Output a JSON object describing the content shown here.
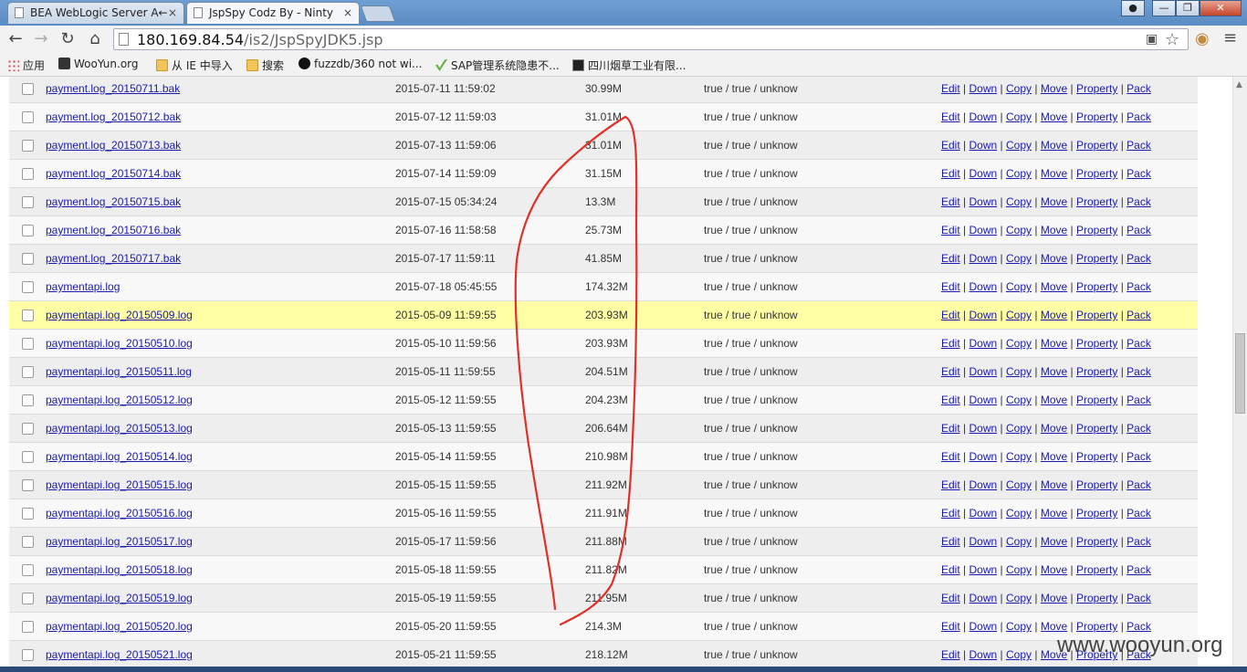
{
  "browser": {
    "tabs": [
      {
        "label": "BEA WebLogic Server A←",
        "active": false
      },
      {
        "label": "JspSpy Codz By - Ninty",
        "active": true
      }
    ],
    "close_glyph": "×",
    "url_host": "180.169.84.54",
    "url_path": "/is2/JspSpyJDK5.jsp",
    "bookmarks": [
      {
        "label": "应用",
        "icon": "apps-grid-icon"
      },
      {
        "label": "WooYun.org",
        "icon": "wooyun-icon"
      },
      {
        "label": "从 IE 中导入",
        "icon": "folder-icon"
      },
      {
        "label": "搜索",
        "icon": "folder-icon"
      },
      {
        "label": "fuzzdb/360 not wi...",
        "icon": "github-icon"
      },
      {
        "label": "SAP管理系统隐患不...",
        "icon": "sap-icon"
      },
      {
        "label": "四川烟草工业有限...",
        "icon": "site-icon"
      }
    ]
  },
  "actions": {
    "edit": "Edit",
    "down": "Down",
    "copy": "Copy",
    "move": "Move",
    "property": "Property",
    "pack": "Pack",
    "separator": "|"
  },
  "files": [
    {
      "name": "payment.log_20150711.bak",
      "date": "2015-07-11 11:59:02",
      "size": "30.99M",
      "perm": "true / true / unknow"
    },
    {
      "name": "payment.log_20150712.bak",
      "date": "2015-07-12 11:59:03",
      "size": "31.01M",
      "perm": "true / true / unknow"
    },
    {
      "name": "payment.log_20150713.bak",
      "date": "2015-07-13 11:59:06",
      "size": "31.01M",
      "perm": "true / true / unknow"
    },
    {
      "name": "payment.log_20150714.bak",
      "date": "2015-07-14 11:59:09",
      "size": "31.15M",
      "perm": "true / true / unknow"
    },
    {
      "name": "payment.log_20150715.bak",
      "date": "2015-07-15 05:34:24",
      "size": "13.3M",
      "perm": "true / true / unknow"
    },
    {
      "name": "payment.log_20150716.bak",
      "date": "2015-07-16 11:58:58",
      "size": "25.73M",
      "perm": "true / true / unknow"
    },
    {
      "name": "payment.log_20150717.bak",
      "date": "2015-07-17 11:59:11",
      "size": "41.85M",
      "perm": "true / true / unknow"
    },
    {
      "name": "paymentapi.log",
      "date": "2015-07-18 05:45:55",
      "size": "174.32M",
      "perm": "true / true / unknow"
    },
    {
      "name": "paymentapi.log_20150509.log",
      "date": "2015-05-09 11:59:55",
      "size": "203.93M",
      "perm": "true / true / unknow"
    },
    {
      "name": "paymentapi.log_20150510.log",
      "date": "2015-05-10 11:59:56",
      "size": "203.93M",
      "perm": "true / true / unknow"
    },
    {
      "name": "paymentapi.log_20150511.log",
      "date": "2015-05-11 11:59:55",
      "size": "204.51M",
      "perm": "true / true / unknow"
    },
    {
      "name": "paymentapi.log_20150512.log",
      "date": "2015-05-12 11:59:55",
      "size": "204.23M",
      "perm": "true / true / unknow"
    },
    {
      "name": "paymentapi.log_20150513.log",
      "date": "2015-05-13 11:59:55",
      "size": "206.64M",
      "perm": "true / true / unknow"
    },
    {
      "name": "paymentapi.log_20150514.log",
      "date": "2015-05-14 11:59:55",
      "size": "210.98M",
      "perm": "true / true / unknow"
    },
    {
      "name": "paymentapi.log_20150515.log",
      "date": "2015-05-15 11:59:55",
      "size": "211.92M",
      "perm": "true / true / unknow"
    },
    {
      "name": "paymentapi.log_20150516.log",
      "date": "2015-05-16 11:59:55",
      "size": "211.91M",
      "perm": "true / true / unknow"
    },
    {
      "name": "paymentapi.log_20150517.log",
      "date": "2015-05-17 11:59:56",
      "size": "211.88M",
      "perm": "true / true / unknow"
    },
    {
      "name": "paymentapi.log_20150518.log",
      "date": "2015-05-18 11:59:55",
      "size": "211.82M",
      "perm": "true / true / unknow"
    },
    {
      "name": "paymentapi.log_20150519.log",
      "date": "2015-05-19 11:59:55",
      "size": "211.95M",
      "perm": "true / true / unknow"
    },
    {
      "name": "paymentapi.log_20150520.log",
      "date": "2015-05-20 11:59:55",
      "size": "214.3M",
      "perm": "true / true / unknow"
    },
    {
      "name": "paymentapi.log_20150521.log",
      "date": "2015-05-21 11:59:55",
      "size": "218.12M",
      "perm": "true / true / unknow"
    }
  ],
  "highlighted_file": "paymentapi.log_20150509.log",
  "colors": {
    "link": "#1a1ab0",
    "highlight_row": "#ffffa6",
    "annotation": "#e0302a"
  },
  "watermark": "www.wooyun.org"
}
